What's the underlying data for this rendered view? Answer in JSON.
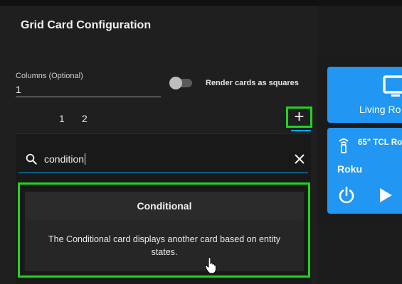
{
  "dialog": {
    "title": "Grid Card Configuration",
    "columns_label": "Columns (Optional)",
    "columns_value": "1",
    "square_label": "Render cards as squares",
    "square_checked": false,
    "tabs": [
      "1",
      "2"
    ],
    "add_label": "+"
  },
  "search": {
    "value": "condition"
  },
  "result": {
    "name": "Conditional",
    "description": "The Conditional card displays another card based on entity states."
  },
  "preview": {
    "card1_label": "Living Ro",
    "card2_title": "65\" TCL Ro",
    "card2_subtitle": "Roku"
  },
  "colors": {
    "accent": "#03a9f4",
    "highlight": "#22d31f",
    "preview_card": "#2196f3"
  }
}
